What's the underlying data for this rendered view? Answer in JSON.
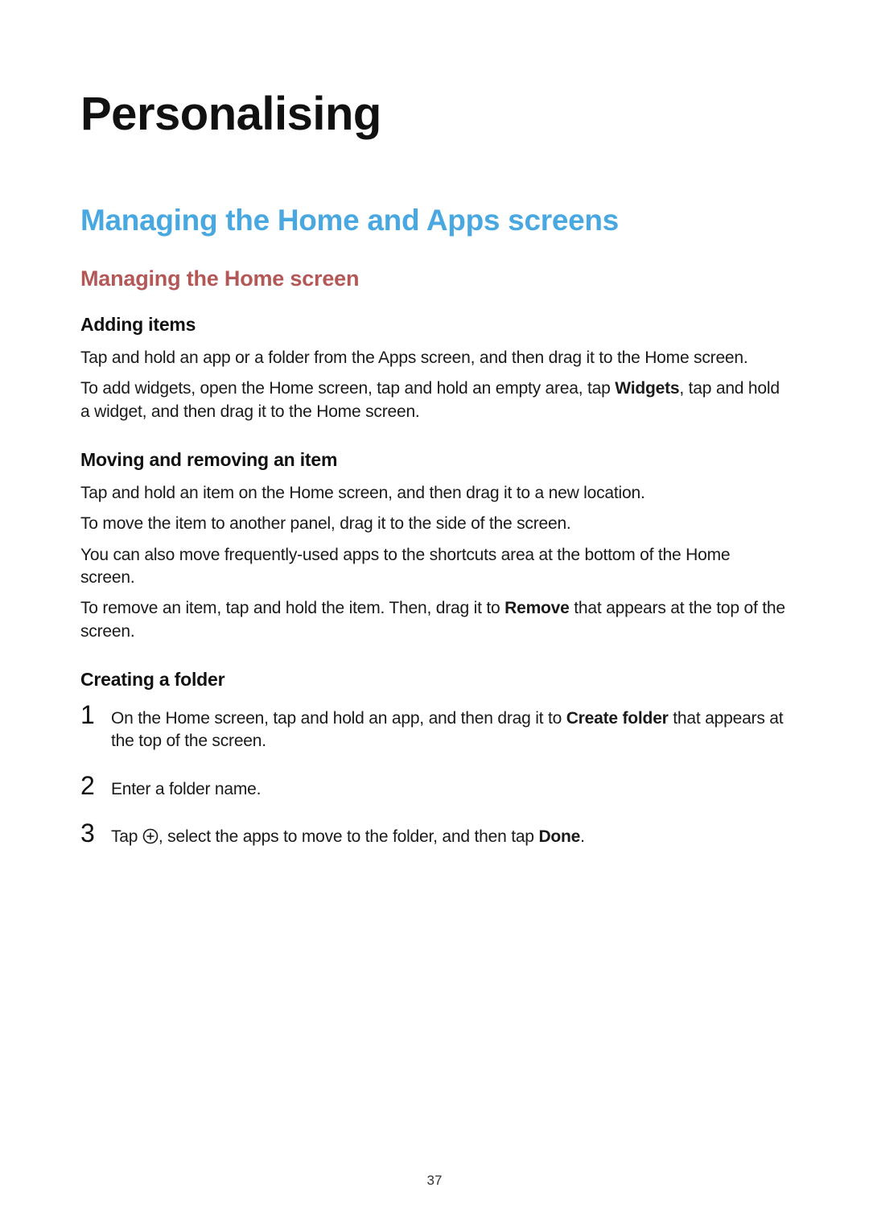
{
  "page_number": "37",
  "h1": "Personalising",
  "h2": "Managing the Home and Apps screens",
  "h3": "Managing the Home screen",
  "sections": {
    "adding_items": {
      "heading": "Adding items",
      "p1": "Tap and hold an app or a folder from the Apps screen, and then drag it to the Home screen.",
      "p2_pre": "To add widgets, open the Home screen, tap and hold an empty area, tap ",
      "p2_bold": "Widgets",
      "p2_post": ", tap and hold a widget, and then drag it to the Home screen."
    },
    "moving": {
      "heading": "Moving and removing an item",
      "p1": "Tap and hold an item on the Home screen, and then drag it to a new location.",
      "p2": "To move the item to another panel, drag it to the side of the screen.",
      "p3": "You can also move frequently-used apps to the shortcuts area at the bottom of the Home screen.",
      "p4_pre": "To remove an item, tap and hold the item. Then, drag it to ",
      "p4_bold": "Remove",
      "p4_post": " that appears at the top of the screen."
    },
    "creating_folder": {
      "heading": "Creating a folder",
      "steps": {
        "s1_num": "1",
        "s1_pre": "On the Home screen, tap and hold an app, and then drag it to ",
        "s1_bold": "Create folder",
        "s1_post": " that appears at the top of the screen.",
        "s2_num": "2",
        "s2_text": "Enter a folder name.",
        "s3_num": "3",
        "s3_pre": "Tap ",
        "s3_mid": ", select the apps to move to the folder, and then tap ",
        "s3_bold": "Done",
        "s3_post": "."
      }
    }
  }
}
